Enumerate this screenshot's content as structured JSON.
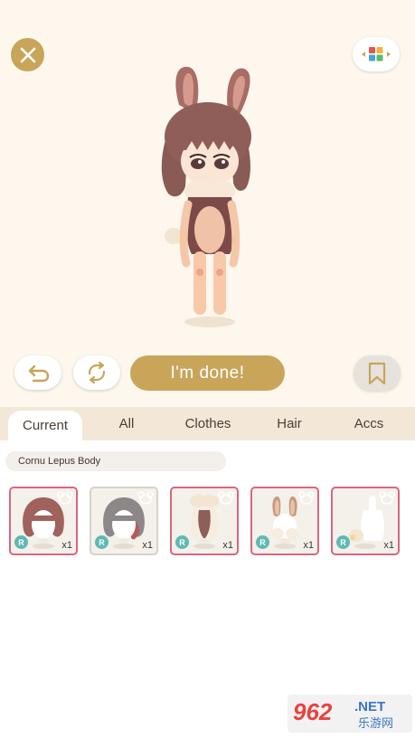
{
  "toolbar": {
    "close_icon": "close-icon",
    "palette_icon": "color-grid-icon",
    "undo_icon": "undo-icon",
    "random_icon": "shuffle-icon",
    "done_label": "I'm done!",
    "bookmark_icon": "bookmark-icon"
  },
  "tabs": [
    {
      "label": "Current",
      "active": true
    },
    {
      "label": "All",
      "active": false
    },
    {
      "label": "Clothes",
      "active": false
    },
    {
      "label": "Hair",
      "active": false
    },
    {
      "label": "Accs",
      "active": false
    }
  ],
  "current_set": {
    "name": "Cornu Lepus Body"
  },
  "items": [
    {
      "rarity": "R",
      "quantity": "x1",
      "icon": "hair-bob-brown-icon"
    },
    {
      "rarity": "R",
      "quantity": "x1",
      "icon": "hair-bob-grey-icon"
    },
    {
      "rarity": "R",
      "quantity": "x1",
      "icon": "hair-accessory-icon"
    },
    {
      "rarity": "R",
      "quantity": "x1",
      "icon": "bunny-ears-icon"
    },
    {
      "rarity": "R",
      "quantity": "x1",
      "icon": "tail-icon"
    }
  ],
  "watermark": {
    "number": "962",
    "suffix": ".NET",
    "chinese": "乐游网"
  },
  "colors": {
    "accent": "#c9a55a",
    "stage_bg": "#fdf7ed",
    "tab_bar_bg": "#f3e7d7",
    "item_border": "#d9667f",
    "rarity_badge": "#5fb9b3"
  }
}
